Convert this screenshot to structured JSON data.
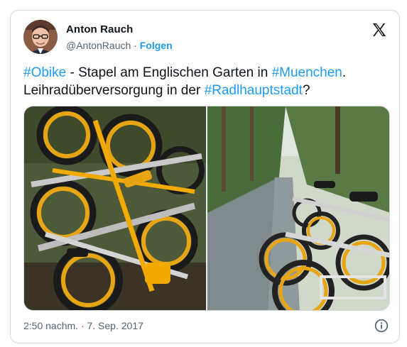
{
  "author": {
    "name": "Anton Rauch",
    "handle": "@AntonRauch",
    "separator": "·",
    "follow_label": "Folgen"
  },
  "tweet": {
    "parts": [
      {
        "text": "#Obike",
        "hashtag": true
      },
      {
        "text": " - Stapel am Englischen Garten in ",
        "hashtag": false
      },
      {
        "text": "#Muenchen",
        "hashtag": true
      },
      {
        "text": ". Leihradüberversorgung in der ",
        "hashtag": false
      },
      {
        "text": "#Radlhauptstadt",
        "hashtag": true
      },
      {
        "text": "?",
        "hashtag": false
      }
    ]
  },
  "footer": {
    "timestamp": "2:50 nachm. · 7. Sep. 2017"
  },
  "icons": {
    "logo": "x-logo-icon",
    "info": "info-icon"
  },
  "colors": {
    "link": "#1d9bf0",
    "text": "#0f1419",
    "muted": "#536471",
    "border": "#cfd9de",
    "bike_yellow": "#f2a900"
  }
}
